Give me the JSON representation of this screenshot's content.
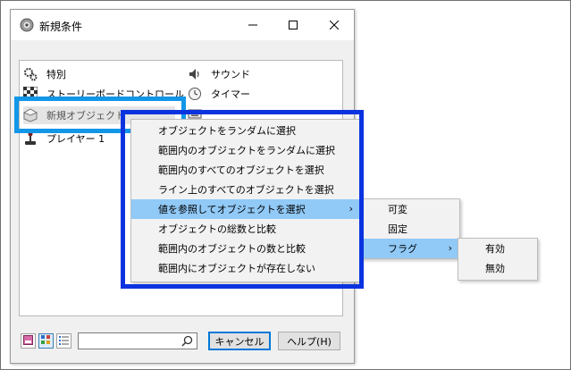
{
  "dialog": {
    "title": "新規条件",
    "controls": {
      "minimize": "—",
      "maximize": "☐",
      "close": "✕"
    }
  },
  "objects": {
    "left": [
      {
        "label": "特別",
        "icon": "gears-icon"
      },
      {
        "label": "ストーリーボードコントロール",
        "icon": "checkerboard-icon"
      },
      {
        "label": "新規オブジェクト",
        "icon": "new-object-icon",
        "selected": true
      },
      {
        "label": "プレイヤー 1",
        "icon": "joystick-icon"
      }
    ],
    "right": [
      {
        "label": "サウンド",
        "icon": "speaker-icon"
      },
      {
        "label": "タイマー",
        "icon": "clock-icon"
      },
      {
        "label": "",
        "icon": "keyboard-icon"
      }
    ]
  },
  "context_menu": {
    "items": [
      "オブジェクトをランダムに選択",
      "範囲内のオブジェクトをランダムに選択",
      "範囲内のすべてのオブジェクトを選択",
      "ライン上のすべてのオブジェクトを選択",
      "値を参照してオブジェクトを選択",
      "オブジェクトの総数と比較",
      "範囲内のオブジェクトの数と比較",
      "範囲内にオブジェクトが存在しない"
    ],
    "highlighted_index": 4,
    "submenu_arrow": "›"
  },
  "submenu1": {
    "items": [
      "可変",
      "固定",
      "フラグ"
    ],
    "highlighted_index": 2,
    "submenu_arrow": "›"
  },
  "submenu2": {
    "items": [
      "有効",
      "無効"
    ]
  },
  "bottom": {
    "search_value": "",
    "cancel_label": "キャンセル",
    "help_label": "ヘルプ(H)"
  },
  "colors": {
    "selection_outline": "#1296e8",
    "menu_outline": "#0a33e0",
    "menu_hover": "#91c9f7"
  }
}
